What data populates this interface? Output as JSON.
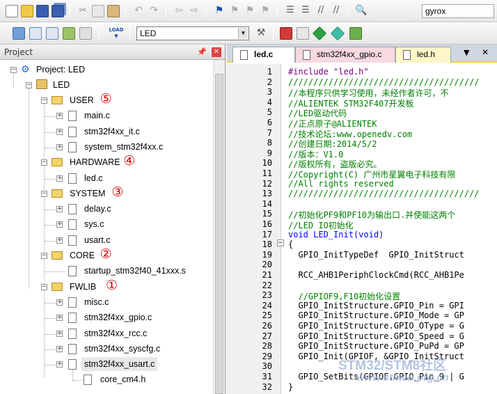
{
  "toolbar1": {
    "find_value": "gyrox"
  },
  "toolbar2": {
    "target_value": "LED",
    "load_label": "LOAD"
  },
  "project": {
    "title": "Project",
    "root": "Project: LED",
    "target": "LED",
    "tree": [
      {
        "label": "USER",
        "type": "folder",
        "marker": "⑤",
        "children": [
          "main.c",
          "stm32f4xx_it.c",
          "system_stm32f4xx.c"
        ]
      },
      {
        "label": "HARDWARE",
        "type": "folder",
        "marker": "④",
        "children": [
          "led.c"
        ]
      },
      {
        "label": "SYSTEM",
        "type": "folder",
        "marker": "③",
        "children": [
          "delay.c",
          "sys.c",
          "usart.c"
        ]
      },
      {
        "label": "CORE",
        "type": "folder",
        "marker": "②",
        "children": [
          "startup_stm32f40_41xxx.s"
        ]
      },
      {
        "label": "FWLIB",
        "type": "folder",
        "marker": "①",
        "children": [
          "misc.c",
          "stm32f4xx_gpio.c",
          "stm32f4xx_rcc.c",
          "stm32f4xx_syscfg.c",
          "stm32f4xx_usart.c"
        ]
      }
    ],
    "extra": "core_cm4.h"
  },
  "editor": {
    "tabs": [
      {
        "label": "led.c",
        "active": true
      },
      {
        "label": "stm32f4xx_gpio.c",
        "active": false
      },
      {
        "label": "led.h",
        "active": false
      }
    ],
    "lines": [
      {
        "n": "1",
        "text": "#include \"led.h\"",
        "cls": "c-pre"
      },
      {
        "n": "2",
        "text": "//////////////////////////////////////",
        "cls": "c-comment"
      },
      {
        "n": "3",
        "text": "//本程序只供学习使用，未经作者许可，不",
        "cls": "c-comment"
      },
      {
        "n": "4",
        "text": "//ALIENTEK STM32F407开发板",
        "cls": "c-comment"
      },
      {
        "n": "5",
        "text": "//LED驱动代码",
        "cls": "c-comment"
      },
      {
        "n": "6",
        "text": "//正点原子@ALIENTEK",
        "cls": "c-comment"
      },
      {
        "n": "7",
        "text": "//技术论坛:www.openedv.com",
        "cls": "c-comment"
      },
      {
        "n": "8",
        "text": "//创建日期:2014/5/2",
        "cls": "c-comment"
      },
      {
        "n": "9",
        "text": "//版本：V1.0",
        "cls": "c-comment"
      },
      {
        "n": "10",
        "text": "//版权所有，盗版必究。",
        "cls": "c-comment"
      },
      {
        "n": "11",
        "text": "//Copyright(C) 广州市星翼电子科技有限",
        "cls": "c-comment"
      },
      {
        "n": "12",
        "text": "//All rights reserved",
        "cls": "c-comment"
      },
      {
        "n": "13",
        "text": "//////////////////////////////////////",
        "cls": "c-comment"
      },
      {
        "n": "14",
        "text": "",
        "cls": "c-norm"
      },
      {
        "n": "15",
        "text": "//初始化PF9和PF10为输出口.并使能这两个",
        "cls": "c-comment"
      },
      {
        "n": "16",
        "text": "//LED IO初始化",
        "cls": "c-comment"
      },
      {
        "n": "17",
        "text": "void LED_Init(void)",
        "cls": "c-kw"
      },
      {
        "n": "18",
        "text": "{",
        "cls": "c-norm"
      },
      {
        "n": "19",
        "text": "  GPIO_InitTypeDef  GPIO_InitStruct",
        "cls": "c-norm"
      },
      {
        "n": "20",
        "text": "",
        "cls": "c-norm"
      },
      {
        "n": "21",
        "text": "  RCC_AHB1PeriphClockCmd(RCC_AHB1Pe",
        "cls": "c-norm"
      },
      {
        "n": "22",
        "text": "",
        "cls": "c-norm"
      },
      {
        "n": "23",
        "text": "  //GPIOF9,F10初始化设置",
        "cls": "c-comment"
      },
      {
        "n": "24",
        "text": "  GPIO_InitStructure.GPIO_Pin = GPI",
        "cls": "c-norm"
      },
      {
        "n": "25",
        "text": "  GPIO_InitStructure.GPIO_Mode = GP",
        "cls": "c-norm"
      },
      {
        "n": "26",
        "text": "  GPIO_InitStructure.GPIO_OType = G",
        "cls": "c-norm"
      },
      {
        "n": "27",
        "text": "  GPIO_InitStructure.GPIO_Speed = G",
        "cls": "c-norm"
      },
      {
        "n": "28",
        "text": "  GPIO_InitStructure.GPIO_PuPd = GP",
        "cls": "c-norm"
      },
      {
        "n": "29",
        "text": "  GPIO_Init(GPIOF, &GPIO_InitStruct",
        "cls": "c-norm"
      },
      {
        "n": "30",
        "text": "",
        "cls": "c-norm"
      },
      {
        "n": "31",
        "text": "  GPIO_SetBits(GPIOF,GPIO_Pin_9 | G",
        "cls": "c-norm"
      },
      {
        "n": "32",
        "text": "}",
        "cls": "c-norm"
      }
    ]
  },
  "watermark": {
    "line1": "STM32/STM8社区",
    "line2": "www.stmcu.org.cn"
  }
}
